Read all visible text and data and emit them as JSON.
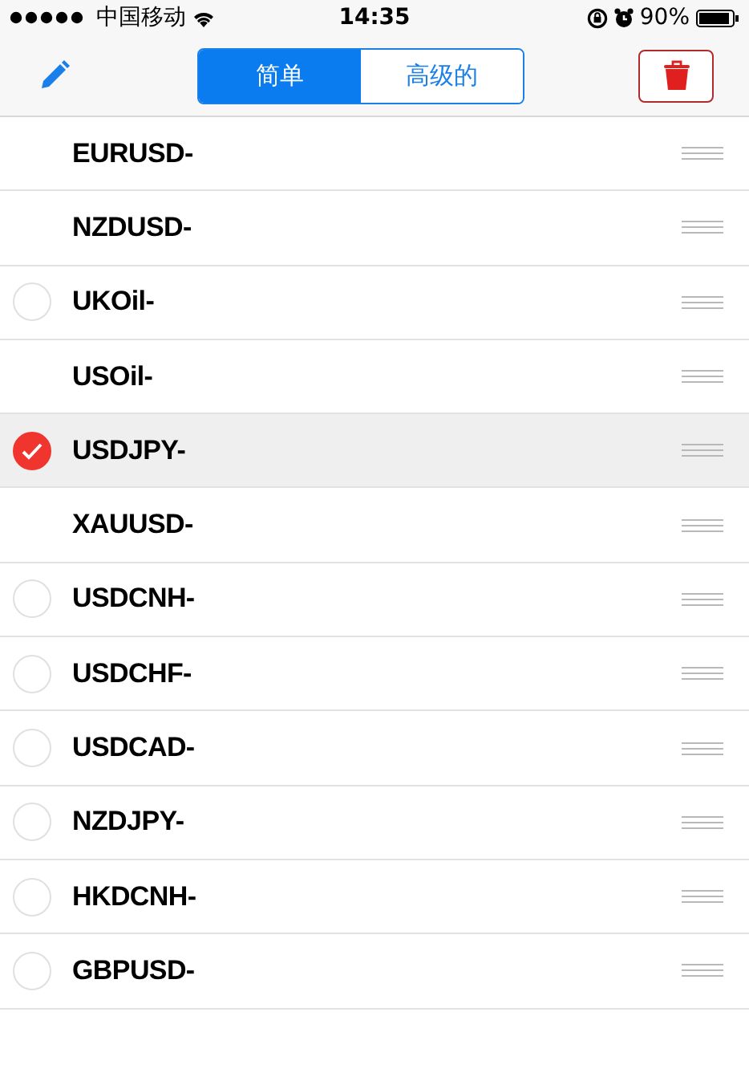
{
  "status_bar": {
    "carrier": "中国移动",
    "time": "14:35",
    "battery": "90%"
  },
  "segments": [
    {
      "label": "简单",
      "selected": true
    },
    {
      "label": "高级的",
      "selected": false
    }
  ],
  "rows": [
    {
      "kind": "plain",
      "name": "EURUSD-"
    },
    {
      "kind": "plain",
      "name": "NZDUSD-"
    },
    {
      "kind": "checkable",
      "name": "UKOil-",
      "checked": false
    },
    {
      "kind": "plain",
      "name": "USOil-"
    },
    {
      "kind": "checkable",
      "name": "USDJPY-",
      "checked": true
    },
    {
      "kind": "plain",
      "name": "XAUUSD-"
    },
    {
      "kind": "checkable",
      "name": "USDCNH-",
      "checked": false
    },
    {
      "kind": "checkable",
      "name": "USDCHF-",
      "checked": false
    },
    {
      "kind": "checkable",
      "name": "USDCAD-",
      "checked": false
    },
    {
      "kind": "checkable",
      "name": "NZDJPY-",
      "checked": false
    },
    {
      "kind": "checkable",
      "name": "HKDCNH-",
      "checked": false
    },
    {
      "kind": "checkable",
      "name": "GBPUSD-",
      "checked": false
    }
  ]
}
